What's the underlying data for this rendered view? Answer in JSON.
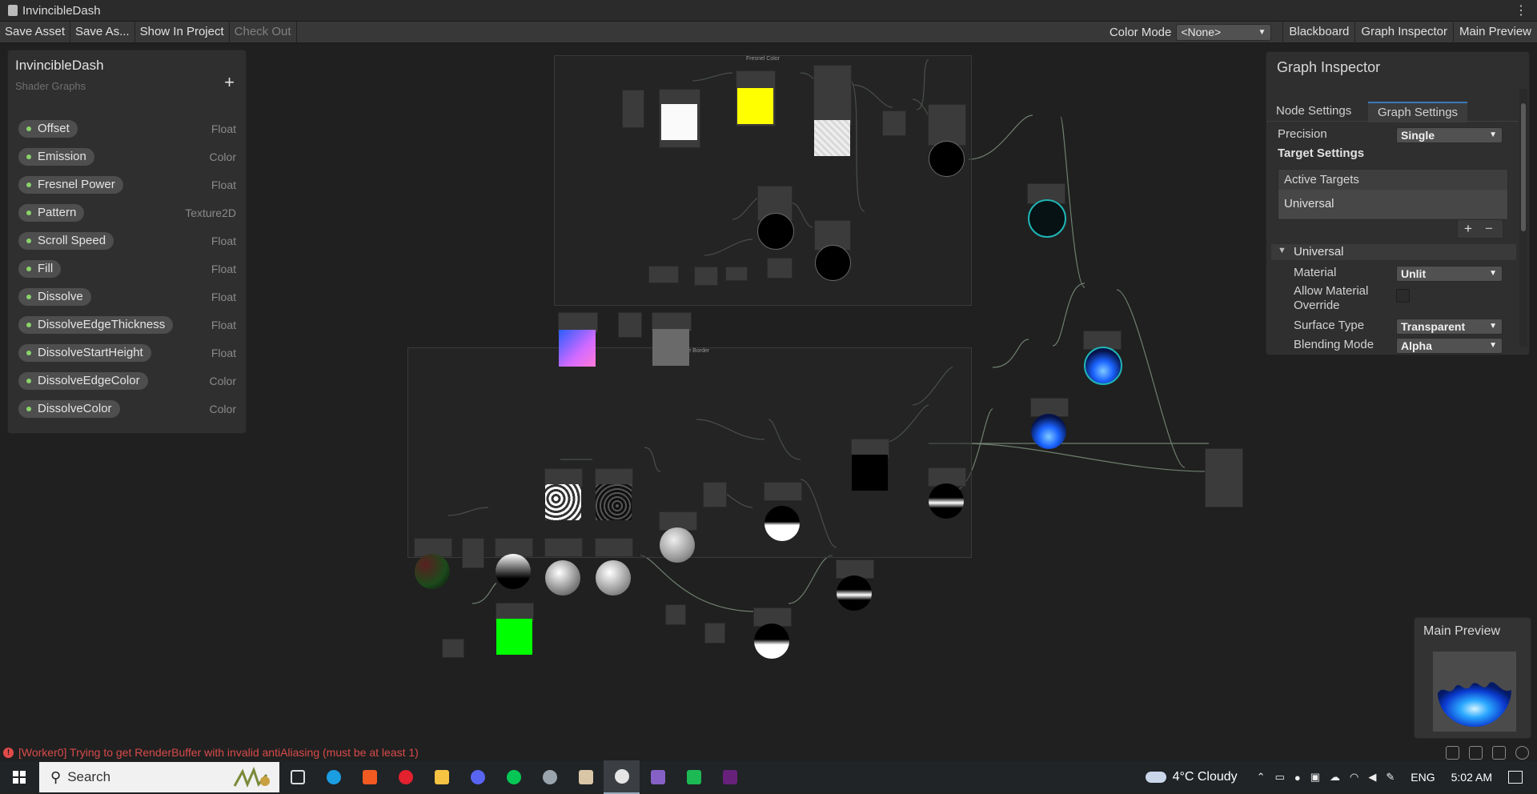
{
  "window": {
    "title": "InvincibleDash"
  },
  "toolbar": {
    "save_asset": "Save Asset",
    "save_as": "Save As...",
    "show_in_project": "Show In Project",
    "check_out": "Check Out",
    "color_mode_label": "Color Mode",
    "color_mode_value": "<None>",
    "blackboard": "Blackboard",
    "graph_inspector": "Graph Inspector",
    "main_preview": "Main Preview"
  },
  "blackboard": {
    "title": "InvincibleDash",
    "subtitle": "Shader Graphs",
    "add": "+",
    "properties": [
      {
        "name": "Offset",
        "type": "Float"
      },
      {
        "name": "Emission",
        "type": "Color"
      },
      {
        "name": "Fresnel Power",
        "type": "Float"
      },
      {
        "name": "Pattern",
        "type": "Texture2D"
      },
      {
        "name": "Scroll Speed",
        "type": "Float"
      },
      {
        "name": "Fill",
        "type": "Float"
      },
      {
        "name": "Dissolve",
        "type": "Float"
      },
      {
        "name": "DissolveEdgeThickness",
        "type": "Float"
      },
      {
        "name": "DissolveStartHeight",
        "type": "Float"
      },
      {
        "name": "DissolveEdgeColor",
        "type": "Color"
      },
      {
        "name": "DissolveColor",
        "type": "Color"
      }
    ]
  },
  "graph": {
    "group1_title": "Fresnel Color",
    "group2_title": "Dissolve Border"
  },
  "inspector": {
    "title": "Graph Inspector",
    "tabs": [
      "Node Settings",
      "Graph Settings"
    ],
    "active_tab": "Graph Settings",
    "precision_label": "Precision",
    "precision_value": "Single",
    "target_settings": "Target Settings",
    "active_targets": "Active Targets",
    "target_item": "Universal",
    "add": "+",
    "remove": "−",
    "section": "Universal",
    "material_label": "Material",
    "material_value": "Unlit",
    "allow_override_label": "Allow Material Override",
    "allow_override_checked": false,
    "surface_type_label": "Surface Type",
    "surface_type_value": "Transparent",
    "blending_mode_label": "Blending Mode",
    "blending_mode_value": "Alpha"
  },
  "main_preview": {
    "title": "Main Preview"
  },
  "status": {
    "message": "[Worker0] Trying to get RenderBuffer with invalid antiAliasing (must be at least 1)"
  },
  "taskbar": {
    "search_placeholder": "Search",
    "weather": "4°C  Cloudy",
    "language": "ENG",
    "time": "5:02 AM"
  },
  "colors": {
    "accent": "#3a79bb",
    "error": "#d94a4a",
    "property_dot": "#8ad36b"
  }
}
